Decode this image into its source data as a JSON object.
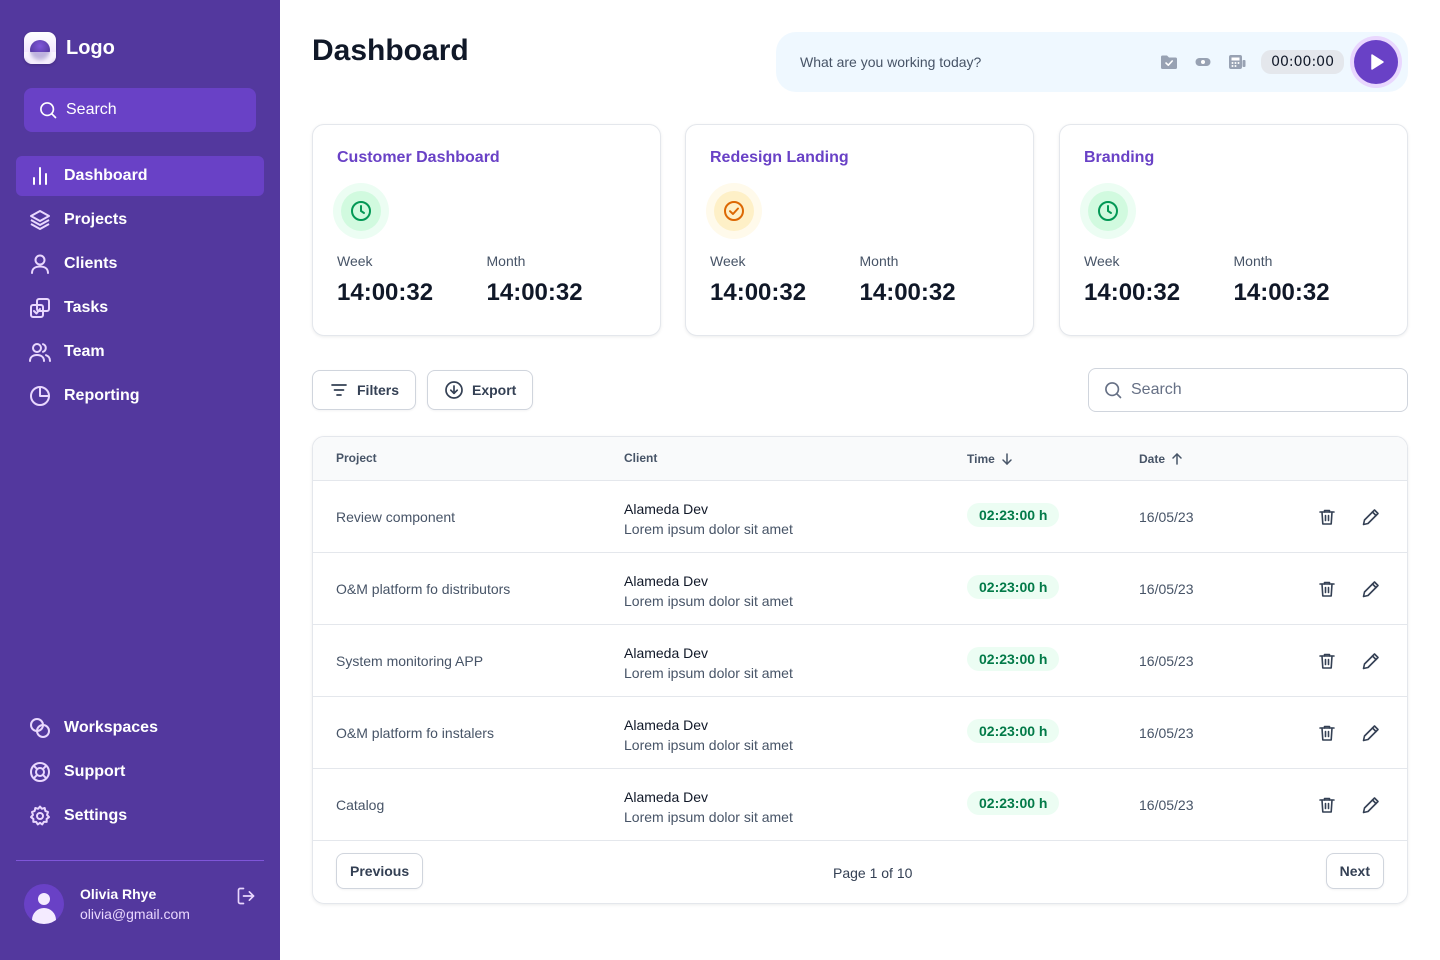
{
  "sidebar": {
    "logo_text": "Logo",
    "search_label": "Search",
    "nav_top": [
      {
        "label": "Dashboard",
        "icon": "bar-chart-icon"
      },
      {
        "label": "Projects",
        "icon": "layers-icon"
      },
      {
        "label": "Clients",
        "icon": "user-icon"
      },
      {
        "label": "Tasks",
        "icon": "tasks-icon"
      },
      {
        "label": "Team",
        "icon": "users-icon"
      },
      {
        "label": "Reporting",
        "icon": "pie-chart-icon"
      }
    ],
    "nav_bottom": [
      {
        "label": "Workspaces",
        "icon": "workspaces-icon"
      },
      {
        "label": "Support",
        "icon": "lifebuoy-icon"
      },
      {
        "label": "Settings",
        "icon": "gear-icon"
      }
    ],
    "active_item": "Dashboard",
    "user": {
      "name": "Olivia Rhye",
      "email": "olivia@gmail.com"
    }
  },
  "header": {
    "title": "Dashboard",
    "timer": {
      "placeholder": "What are you working today?",
      "value": "00:00:00"
    }
  },
  "cards": [
    {
      "title": "Customer Dashboard",
      "icon": "clock-icon",
      "icon_color": "#12b76a",
      "week_label": "Week",
      "week_value": "14:00:32",
      "month_label": "Month",
      "month_value": "14:00:32"
    },
    {
      "title": "Redesign Landing",
      "icon": "check-circle-icon",
      "icon_color": "#dc6803",
      "week_label": "Week",
      "week_value": "14:00:32",
      "month_label": "Month",
      "month_value": "14:00:32"
    },
    {
      "title": "Branding",
      "icon": "clock-icon",
      "icon_color": "#12b76a",
      "week_label": "Week",
      "week_value": "14:00:32",
      "month_label": "Month",
      "month_value": "14:00:32"
    }
  ],
  "toolbar": {
    "filters_label": "Filters",
    "export_label": "Export",
    "search_placeholder": "Search"
  },
  "table": {
    "columns": {
      "project": "Project",
      "client": "Client",
      "time": "Time",
      "date": "Date"
    },
    "rows": [
      {
        "project": "Review component",
        "client": "Alameda Dev",
        "client_desc": "Lorem ipsum dolor sit amet",
        "time": "02:23:00 h",
        "date": "16/05/23"
      },
      {
        "project": "O&M platform fo distributors",
        "client": "Alameda Dev",
        "client_desc": "Lorem ipsum dolor sit amet",
        "time": "02:23:00 h",
        "date": "16/05/23"
      },
      {
        "project": "System monitoring APP",
        "client": "Alameda Dev",
        "client_desc": "Lorem ipsum dolor sit amet",
        "time": "02:23:00 h",
        "date": "16/05/23"
      },
      {
        "project": "O&M platform fo instalers",
        "client": "Alameda Dev",
        "client_desc": "Lorem ipsum dolor sit amet",
        "time": "02:23:00 h",
        "date": "16/05/23"
      },
      {
        "project": "Catalog",
        "client": "Alameda Dev",
        "client_desc": "Lorem ipsum dolor sit amet",
        "time": "02:23:00 h",
        "date": "16/05/23"
      }
    ],
    "pagination": {
      "previous": "Previous",
      "page_text": "Page 1 of 10",
      "next": "Next"
    }
  },
  "colors": {
    "sidebar_bg": "#53389e",
    "accent": "#6941c6",
    "success": "#027a48",
    "warning": "#dc6803"
  }
}
